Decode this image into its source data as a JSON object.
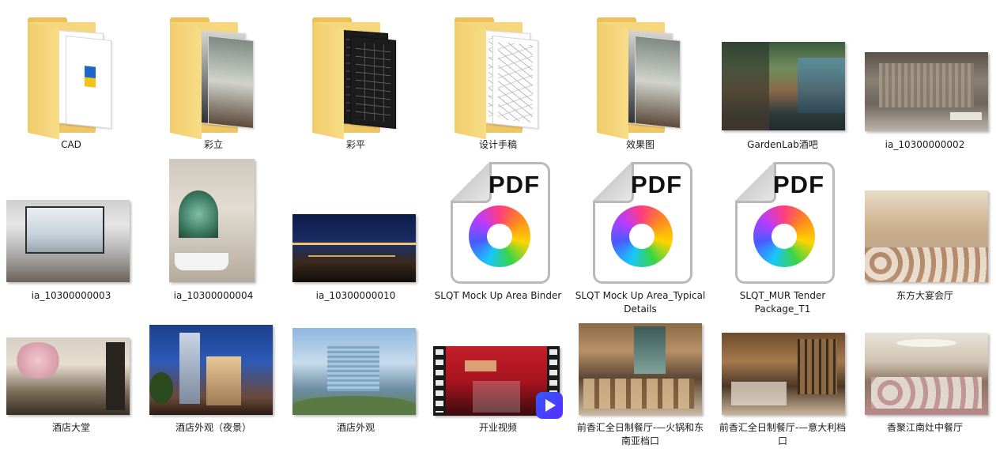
{
  "view": {
    "name": "file-explorer-large-icons"
  },
  "items": [
    {
      "name": "CAD",
      "kind": "folder"
    },
    {
      "name": "彩立",
      "kind": "folder"
    },
    {
      "name": "彩平",
      "kind": "folder"
    },
    {
      "name": "设计手稿",
      "kind": "folder"
    },
    {
      "name": "效果图",
      "kind": "folder"
    },
    {
      "name": "GardenLab酒吧",
      "kind": "image"
    },
    {
      "name": "ia_10300000002",
      "kind": "image"
    },
    {
      "name": "ia_10300000003",
      "kind": "image"
    },
    {
      "name": "ia_10300000004",
      "kind": "image"
    },
    {
      "name": "ia_10300000010",
      "kind": "image"
    },
    {
      "name": "SLQT Mock Up Area Binder",
      "kind": "pdf"
    },
    {
      "name": "SLQT Mock Up Area_Typical Details",
      "kind": "pdf"
    },
    {
      "name": "SLQT_MUR Tender Package_T1",
      "kind": "pdf"
    },
    {
      "name": "东方大宴会厅",
      "kind": "image"
    },
    {
      "name": "酒店大堂",
      "kind": "image"
    },
    {
      "name": "酒店外观（夜景）",
      "kind": "image"
    },
    {
      "name": "酒店外观",
      "kind": "image"
    },
    {
      "name": "开业视频",
      "kind": "video"
    },
    {
      "name": "前香汇全日制餐厅-—火锅和东南亚档口",
      "kind": "image"
    },
    {
      "name": "前香汇全日制餐厅-—意大利档口",
      "kind": "image"
    },
    {
      "name": "香聚江南灶中餐厅",
      "kind": "image"
    }
  ],
  "pdf_badge_text": "PDF",
  "icons": {
    "folder": "folder-icon",
    "pdf": "pdf-file-icon",
    "video": "video-file-icon",
    "image": "image-thumbnail"
  }
}
